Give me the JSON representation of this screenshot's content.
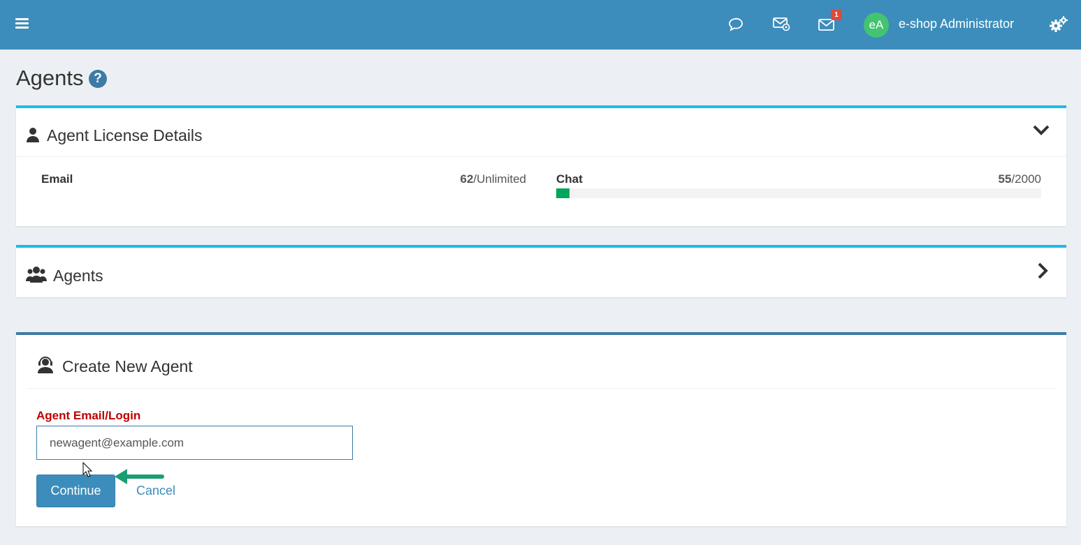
{
  "topbar": {
    "menu_icon": "hamburger-icon",
    "chat_icon": "speech-bubble-icon",
    "mail_settings_icon": "envelope-gear-icon",
    "mail_icon": "envelope-icon",
    "mail_badge": "1",
    "avatar_initials": "eA",
    "user_name": "e-shop Administrator",
    "settings_icon": "gears-icon",
    "bar_color": "#3c8dbc"
  },
  "page": {
    "title": "Agents",
    "help_icon": "?"
  },
  "license": {
    "title": "Agent License Details",
    "icon": "user-icon",
    "toggle_icon": "chevron-down-icon",
    "email_label": "Email",
    "email_used": "62",
    "email_limit": "/Unlimited",
    "chat_label": "Chat",
    "chat_used": "55",
    "chat_limit": "/2000",
    "chat_progress_fraction": 0.0275,
    "progress_color": "#00a65a"
  },
  "agents_section": {
    "title": "Agents",
    "icon": "users-icon",
    "toggle_icon": "chevron-right-icon"
  },
  "create_agent": {
    "title": "Create New Agent",
    "icon": "headset-agent-icon",
    "field_label": "Agent Email/Login",
    "field_value": "newagent@example.com",
    "continue_label": "Continue",
    "cancel_label": "Cancel",
    "label_color": "#c00000"
  }
}
